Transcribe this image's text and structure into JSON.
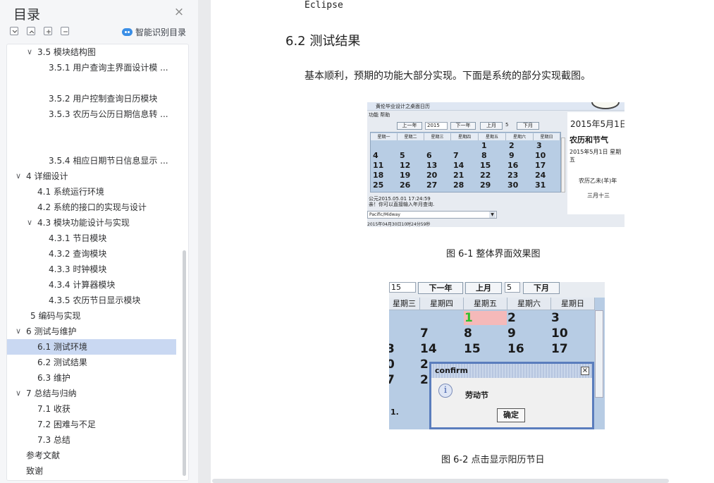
{
  "sidebar": {
    "title": "目录",
    "smart_toc_label": "智能识别目录",
    "items": [
      {
        "label": "3.5  模块结构图",
        "level": 1,
        "expanded": true
      },
      {
        "label": "3.5.1  用户查询主界面设计模 ...",
        "level": 2
      },
      {
        "label": "3.5.2  用户控制查询日历模块",
        "level": 2
      },
      {
        "label": "3.5.3  农历与公历日期信息转 ...",
        "level": 2
      },
      {
        "label": "3.5.4 相应日期节日信息显示 ...",
        "level": 2
      },
      {
        "label": "4  详细设计",
        "level": 0,
        "expanded": true
      },
      {
        "label": "4.1  系统运行环境",
        "level": 1
      },
      {
        "label": "4.2  系统的接口的实现与设计",
        "level": 1
      },
      {
        "label": "4.3 模块功能设计与实现",
        "level": 1,
        "expanded": true
      },
      {
        "label": "4.3.1  节日模块",
        "level": 2
      },
      {
        "label": "4.3.2  查询模块",
        "level": 2
      },
      {
        "label": "4.3.3  时钟模块",
        "level": 2
      },
      {
        "label": "4.3.4  计算器模块",
        "level": 2
      },
      {
        "label": "4.3.5  农历节日显示模块",
        "level": 2
      },
      {
        "label": "5  编码与实现",
        "level": 0
      },
      {
        "label": "6  测试与维护",
        "level": 0,
        "expanded": true
      },
      {
        "label": "6.1 测试环境",
        "level": 1,
        "active": true
      },
      {
        "label": "6.2  测试结果",
        "level": 1
      },
      {
        "label": "6.3  维护",
        "level": 1
      },
      {
        "label": "7  总结与归纳",
        "level": 0,
        "expanded": true
      },
      {
        "label": "7.1  收获",
        "level": 1
      },
      {
        "label": "7.2  困难与不足",
        "level": 1
      },
      {
        "label": "7.3  总结",
        "level": 1
      },
      {
        "label": "参考文献",
        "level": 0
      },
      {
        "label": "致谢",
        "level": 0
      }
    ]
  },
  "document": {
    "top_text": "Eclipse",
    "section_heading": "6.2 测试结果",
    "paragraph": "基本顺利，预期的功能大部分实现。下面是系统的部分实现截图。",
    "caption1": "图 6-1 整体界面效果图",
    "caption2": "图 6-2 点击显示阳历节日"
  },
  "figure1": {
    "window_title": "黄伦毕业设计之桌面日历",
    "menu": "功能  帮助",
    "buttons": [
      "上一年",
      "下一年",
      "上月",
      "下月"
    ],
    "year_value": "2015",
    "month_value": "5",
    "weekdays": [
      "星期一",
      "星期二",
      "星期三",
      "星期四",
      "星期五",
      "星期六",
      "星期日"
    ],
    "weeks": [
      [
        "",
        "",
        "",
        "",
        "1",
        "2",
        "3"
      ],
      [
        "4",
        "5",
        "6",
        "7",
        "8",
        "9",
        "10"
      ],
      [
        "11",
        "12",
        "13",
        "14",
        "15",
        "16",
        "17"
      ],
      [
        "18",
        "19",
        "20",
        "21",
        "22",
        "23",
        "24"
      ],
      [
        "25",
        "26",
        "27",
        "28",
        "29",
        "30",
        "31"
      ]
    ],
    "info_line1": "公元2015.05.01 17:24:59",
    "info_line2": "亲！你可以直接输入年月查询.",
    "timezone": "Pacific/Midway",
    "timezone_time": "2015年04月30日10时24分59秒",
    "right_date": "2015年5月1日",
    "right_lunar_title": "农历和节气",
    "right_line1": "2015年5月1日  星期",
    "right_line2": "五",
    "right_line3": "农历乙未(羊)年",
    "right_line4": "三月十三"
  },
  "figure2": {
    "year_value": "15",
    "month_value": "5",
    "buttons": [
      "下一年",
      "上月",
      "下月"
    ],
    "weekdays": [
      "星期三",
      "星期四",
      "星期五",
      "星期六",
      "星期日"
    ],
    "rows": [
      [
        "",
        "",
        "1",
        "2",
        "3"
      ],
      [
        "",
        "7",
        "8",
        "9",
        "10"
      ],
      [
        "3",
        "14",
        "15",
        "16",
        "17"
      ],
      [
        "0",
        "2",
        "",
        "",
        ""
      ],
      [
        "7",
        "2",
        "",
        "",
        ""
      ]
    ],
    "bottom_fragment": "1.",
    "dialog_title": "confirm",
    "dialog_message": "劳动节",
    "dialog_ok": "确定",
    "highlight_color": "#f5b9b9",
    "today_color": "#2bbf2b"
  }
}
